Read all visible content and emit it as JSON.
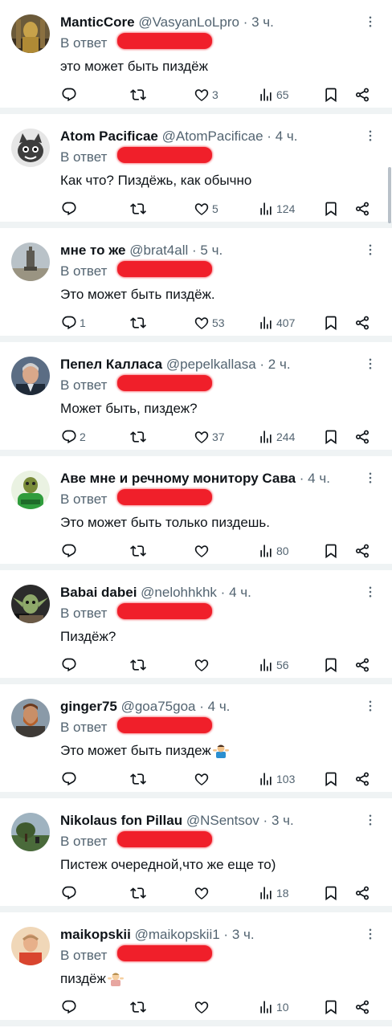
{
  "colors": {
    "text": "#0f1419",
    "secondary": "#536471",
    "separator": "#eff3f4",
    "redaction": "#f01f2a"
  },
  "icons": {
    "reply": "reply-icon",
    "retweet": "retweet-icon",
    "like": "heart-icon",
    "views": "views-bar-chart-icon",
    "bookmark": "bookmark-icon",
    "share": "share-icon",
    "more": "more-vertical-icon"
  },
  "tweets": [
    {
      "name": "ManticCore",
      "handle": "@VasyanLoLpro",
      "sep": "·",
      "time": "3 ч.",
      "reply_prefix": "В ответ",
      "text": "это может быть пиздёж",
      "replies": "",
      "retweets": "",
      "likes": "3",
      "views": "65",
      "avatar": "gold-figure"
    },
    {
      "name": "Atom Pacificae",
      "handle": "@AtomPacificae",
      "sep": "·",
      "time": "4 ч.",
      "reply_prefix": "В ответ",
      "text": "Как что? Пиздёжь, как обычно",
      "replies": "",
      "retweets": "",
      "likes": "5",
      "views": "124",
      "avatar": "cartoon-cat"
    },
    {
      "name": "мне то же",
      "handle": "@brat4all",
      "sep": "·",
      "time": "5 ч.",
      "reply_prefix": "В ответ",
      "text": "Это может быть пиздёж.",
      "replies": "1",
      "retweets": "",
      "likes": "53",
      "views": "407",
      "avatar": "monument"
    },
    {
      "name": "Пепел Калласа",
      "handle": "@pepelkallasa",
      "sep": "·",
      "time": "2 ч.",
      "reply_prefix": "В ответ",
      "text": "Может быть, пиздеж?",
      "replies": "2",
      "retweets": "",
      "likes": "37",
      "views": "244",
      "avatar": "man-portrait"
    },
    {
      "name": "Аве мне и речному монитору Сава",
      "handle": "",
      "sep": "·",
      "time": "4 ч.",
      "reply_prefix": "В ответ",
      "text": "Это может быть только пиздешь.",
      "replies": "",
      "retweets": "",
      "likes": "",
      "views": "80",
      "avatar": "lizard-hoodie"
    },
    {
      "name": "Babai dabei",
      "handle": "@nelohhkhk",
      "sep": "·",
      "time": "4 ч.",
      "reply_prefix": "В ответ",
      "text": "Пиздёж?",
      "replies": "",
      "retweets": "",
      "likes": "",
      "views": "56",
      "avatar": "yoda"
    },
    {
      "name": "ginger75",
      "handle": "@goa75goa",
      "sep": "·",
      "time": "4 ч.",
      "reply_prefix": "В ответ",
      "text": "Это может быть пиздеж",
      "emoji": "shrug",
      "replies": "",
      "retweets": "",
      "likes": "",
      "views": "103",
      "avatar": "bearded-man"
    },
    {
      "name": "Nikolaus fon Pillau",
      "handle": "@NSentsov",
      "sep": "·",
      "time": "3 ч.",
      "reply_prefix": "В ответ",
      "text": "Пистеж очередной,что же еще то)",
      "replies": "",
      "retweets": "",
      "likes": "",
      "views": "18",
      "avatar": "tree-landscape"
    },
    {
      "name": "maikopskii",
      "handle": "@maikopskii1",
      "sep": "·",
      "time": "3 ч.",
      "reply_prefix": "В ответ",
      "text": "пиздёж",
      "emoji": "shrug-light",
      "replies": "",
      "retweets": "",
      "likes": "",
      "views": "10",
      "avatar": "person-red-shirt"
    }
  ]
}
